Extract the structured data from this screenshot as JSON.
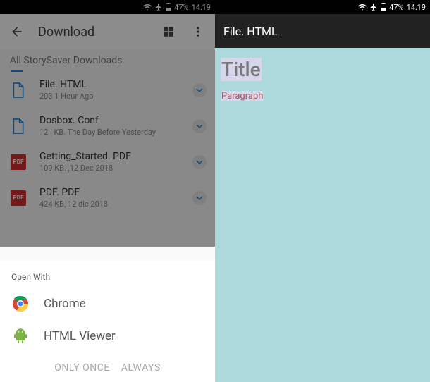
{
  "status": {
    "battery": "47%",
    "time": "14:19"
  },
  "left": {
    "toolbar_title": "Download",
    "folder": "All StorySaver Downloads",
    "files": [
      {
        "name": "File. HTML",
        "meta": "203 1 Hour Ago",
        "type": "doc"
      },
      {
        "name": "Dosbox. Conf",
        "meta": "12 | KB. The Day Before Yesterday",
        "type": "doc"
      },
      {
        "name": "Getting_Started. PDF",
        "meta": "109 KB. ,12 Dec 2018",
        "type": "pdf"
      },
      {
        "name": "PDF. PDF",
        "meta": "424 KB, 12 dic 2018",
        "type": "pdf"
      }
    ],
    "sheet": {
      "title": "Open With",
      "apps": [
        {
          "name": "Chrome"
        },
        {
          "name": "HTML Viewer"
        }
      ],
      "action_once": "ONLY ONCE",
      "action_always": "ALWAYS"
    }
  },
  "right": {
    "header": "File. HTML",
    "title": "Title",
    "paragraph": "Paragraph"
  }
}
